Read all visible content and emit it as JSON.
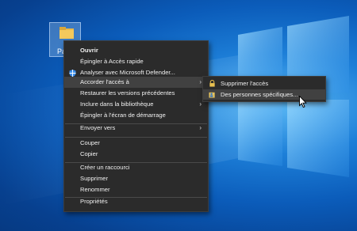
{
  "desktop": {
    "icon_label": "Pa"
  },
  "context_menu": {
    "items": [
      {
        "label": "Ouvrir"
      },
      {
        "label": "Épingler à Accès rapide"
      },
      {
        "label": "Analyser avec Microsoft Defender..."
      },
      {
        "label": "Accorder l'accès à"
      },
      {
        "label": "Restaurer les versions précédentes"
      },
      {
        "label": "Inclure dans la bibliothèque"
      },
      {
        "label": "Épingler à l'écran de démarrage"
      },
      {
        "label": "Envoyer vers"
      },
      {
        "label": "Couper"
      },
      {
        "label": "Copier"
      },
      {
        "label": "Créer un raccourci"
      },
      {
        "label": "Supprimer"
      },
      {
        "label": "Renommer"
      },
      {
        "label": "Propriétés"
      }
    ]
  },
  "submenu": {
    "items": [
      {
        "label": "Supprimer l'accès",
        "icon": "lock-icon"
      },
      {
        "label": "Des personnes spécifiques...",
        "icon": "users-icon"
      }
    ]
  },
  "colors": {
    "menu_bg": "#2b2b2b",
    "highlight": "#414141",
    "desktop_accent": "#0b5cba"
  }
}
